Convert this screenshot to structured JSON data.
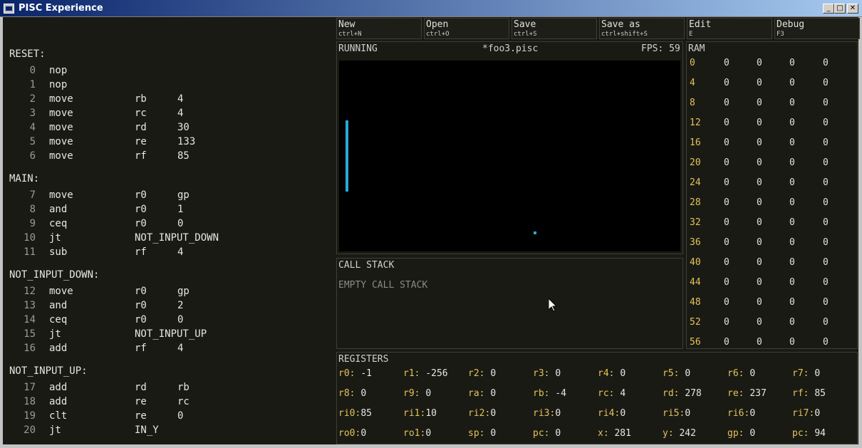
{
  "window": {
    "title": "PISC Experience"
  },
  "toolbar": [
    {
      "label": "New",
      "shortcut": "ctrl+N"
    },
    {
      "label": "Open",
      "shortcut": "ctrl+O"
    },
    {
      "label": "Save",
      "shortcut": "ctrl+S"
    },
    {
      "label": "Save as",
      "shortcut": "ctrl+shift+S"
    },
    {
      "label": "Edit",
      "shortcut": "E"
    },
    {
      "label": "Debug",
      "shortcut": "F3"
    }
  ],
  "display": {
    "status": "RUNNING",
    "filename": "*foo3.pisc",
    "fps": "FPS: 59"
  },
  "call_stack": {
    "title": "CALL STACK",
    "empty": "EMPTY CALL STACK"
  },
  "ram": {
    "title": "RAM",
    "rows": [
      {
        "addr": "0",
        "v": [
          "0",
          "0",
          "0",
          "0"
        ]
      },
      {
        "addr": "4",
        "v": [
          "0",
          "0",
          "0",
          "0"
        ]
      },
      {
        "addr": "8",
        "v": [
          "0",
          "0",
          "0",
          "0"
        ]
      },
      {
        "addr": "12",
        "v": [
          "0",
          "0",
          "0",
          "0"
        ]
      },
      {
        "addr": "16",
        "v": [
          "0",
          "0",
          "0",
          "0"
        ]
      },
      {
        "addr": "20",
        "v": [
          "0",
          "0",
          "0",
          "0"
        ]
      },
      {
        "addr": "24",
        "v": [
          "0",
          "0",
          "0",
          "0"
        ]
      },
      {
        "addr": "28",
        "v": [
          "0",
          "0",
          "0",
          "0"
        ]
      },
      {
        "addr": "32",
        "v": [
          "0",
          "0",
          "0",
          "0"
        ]
      },
      {
        "addr": "36",
        "v": [
          "0",
          "0",
          "0",
          "0"
        ]
      },
      {
        "addr": "40",
        "v": [
          "0",
          "0",
          "0",
          "0"
        ]
      },
      {
        "addr": "44",
        "v": [
          "0",
          "0",
          "0",
          "0"
        ]
      },
      {
        "addr": "48",
        "v": [
          "0",
          "0",
          "0",
          "0"
        ]
      },
      {
        "addr": "52",
        "v": [
          "0",
          "0",
          "0",
          "0"
        ]
      },
      {
        "addr": "56",
        "v": [
          "0",
          "0",
          "0",
          "0"
        ]
      }
    ]
  },
  "registers": {
    "title": "REGISTERS",
    "rows": [
      [
        [
          "r0:",
          "-1"
        ],
        [
          "r1:",
          "-256"
        ],
        [
          "r2:",
          "0"
        ],
        [
          "r3:",
          "0"
        ],
        [
          "r4:",
          "0"
        ],
        [
          "r5:",
          "0"
        ],
        [
          "r6:",
          "0"
        ],
        [
          "r7:",
          "0"
        ]
      ],
      [
        [
          "r8:",
          "0"
        ],
        [
          "r9:",
          "0"
        ],
        [
          "ra:",
          "0"
        ],
        [
          "rb:",
          "-4"
        ],
        [
          "rc:",
          "4"
        ],
        [
          "rd:",
          "278"
        ],
        [
          "re:",
          "237"
        ],
        [
          "rf:",
          "85"
        ]
      ],
      [
        [
          "ri0:",
          "85"
        ],
        [
          "ri1:",
          "10"
        ],
        [
          "ri2:",
          "0"
        ],
        [
          "ri3:",
          "0"
        ],
        [
          "ri4:",
          "0"
        ],
        [
          "ri5:",
          "0"
        ],
        [
          "ri6:",
          "0"
        ],
        [
          "ri7:",
          "0"
        ]
      ],
      [
        [
          "ro0:",
          "0"
        ],
        [
          "ro1:",
          "0"
        ],
        [
          "sp:",
          "0"
        ],
        [
          "pc:",
          "0"
        ],
        [
          "x:",
          "281"
        ],
        [
          "y:",
          "242"
        ],
        [
          "gp:",
          "0"
        ],
        [
          "pc:",
          "94"
        ]
      ]
    ]
  },
  "code": [
    {
      "label": "RESET:"
    },
    {
      "n": "0",
      "op": "nop"
    },
    {
      "n": "1",
      "op": "nop"
    },
    {
      "n": "2",
      "op": "move",
      "a1": "rb",
      "a2": "4"
    },
    {
      "n": "3",
      "op": "move",
      "a1": "rc",
      "a2": "4"
    },
    {
      "n": "4",
      "op": "move",
      "a1": "rd",
      "a2": "30"
    },
    {
      "n": "5",
      "op": "move",
      "a1": "re",
      "a2": "133"
    },
    {
      "n": "6",
      "op": "move",
      "a1": "rf",
      "a2": "85"
    },
    {
      "label": "MAIN:"
    },
    {
      "n": "7",
      "op": "move",
      "a1": "r0",
      "a2": "gp"
    },
    {
      "n": "8",
      "op": "and",
      "a1": "r0",
      "a2": "1"
    },
    {
      "n": "9",
      "op": "ceq",
      "a1": "r0",
      "a2": "0"
    },
    {
      "n": "10",
      "op": "jt",
      "a1": "NOT_INPUT_DOWN"
    },
    {
      "n": "11",
      "op": "sub",
      "a1": "rf",
      "a2": "4"
    },
    {
      "label": "NOT_INPUT_DOWN:"
    },
    {
      "n": "12",
      "op": "move",
      "a1": "r0",
      "a2": "gp"
    },
    {
      "n": "13",
      "op": "and",
      "a1": "r0",
      "a2": "2"
    },
    {
      "n": "14",
      "op": "ceq",
      "a1": "r0",
      "a2": "0"
    },
    {
      "n": "15",
      "op": "jt",
      "a1": "NOT_INPUT_UP"
    },
    {
      "n": "16",
      "op": "add",
      "a1": "rf",
      "a2": "4"
    },
    {
      "label": "NOT_INPUT_UP:"
    },
    {
      "n": "17",
      "op": "add",
      "a1": "rd",
      "a2": "rb"
    },
    {
      "n": "18",
      "op": "add",
      "a1": "re",
      "a2": "rc"
    },
    {
      "n": "19",
      "op": "clt",
      "a1": "re",
      "a2": "0"
    },
    {
      "n": "20",
      "op": "jt",
      "a1": "IN_Y"
    }
  ]
}
